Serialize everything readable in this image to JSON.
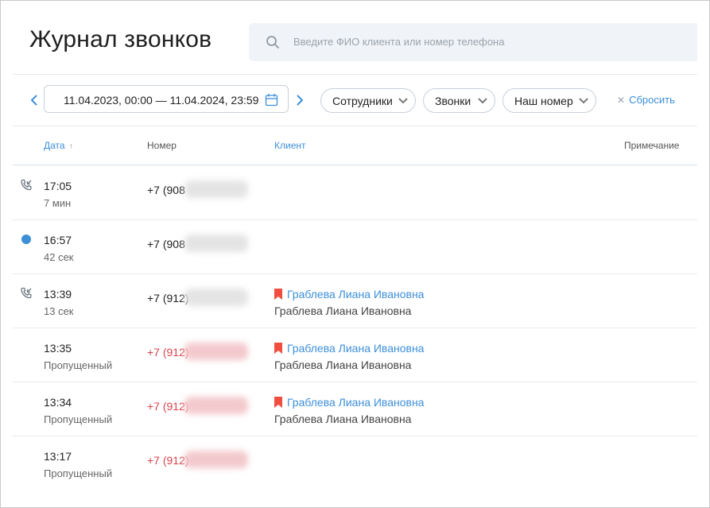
{
  "page": {
    "title": "Журнал звонков"
  },
  "search": {
    "placeholder": "Введите ФИО клиента или номер телефона"
  },
  "filters": {
    "date_range": "11.04.2023, 00:00 — 11.04.2024, 23:59",
    "employees": "Сотрудники",
    "calls": "Звонки",
    "our_number": "Наш номер",
    "reset": "Сбросить"
  },
  "table": {
    "headers": {
      "date": "Дата",
      "sort_arrow": "↑",
      "number": "Номер",
      "client": "Клиент",
      "note": "Примечание"
    },
    "rows": [
      {
        "status": "incoming",
        "time": "17:05",
        "duration": "7 мин",
        "number": "+7 (908",
        "missed": false,
        "client": "",
        "client_sub": ""
      },
      {
        "status": "active",
        "time": "16:57",
        "duration": "42 сек",
        "number": "+7 (908",
        "missed": false,
        "client": "",
        "client_sub": ""
      },
      {
        "status": "incoming",
        "time": "13:39",
        "duration": "13 сек",
        "number": "+7 (912)",
        "missed": false,
        "client": "Граблева Лиана Ивановна",
        "client_sub": "Граблева Лиана Ивановна"
      },
      {
        "status": "missed",
        "time": "13:35",
        "duration": "Пропущенный",
        "number": "+7 (912)",
        "missed": true,
        "client": "Граблева Лиана Ивановна",
        "client_sub": "Граблева Лиана Ивановна"
      },
      {
        "status": "missed",
        "time": "13:34",
        "duration": "Пропущенный",
        "number": "+7 (912)",
        "missed": true,
        "client": "Граблева Лиана Ивановна",
        "client_sub": "Граблева Лиана Ивановна"
      },
      {
        "status": "missed",
        "time": "13:17",
        "duration": "Пропущенный",
        "number": "+7 (912)",
        "missed": true,
        "client": "",
        "client_sub": ""
      }
    ]
  },
  "colors": {
    "accent": "#3d8fd8",
    "missed": "#d6434d",
    "bookmark": "#f04e3e"
  }
}
